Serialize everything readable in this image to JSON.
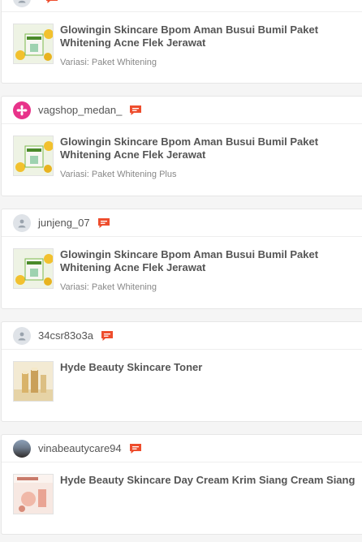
{
  "orders": [
    {
      "username": "",
      "avatar": "default",
      "product": {
        "title": "Glowingin Skincare Bpom Aman Busui Bumil Paket Whitening Acne Flek Jerawat",
        "variant": "Variasi: Paket Whitening",
        "thumb": "whitening-box"
      }
    },
    {
      "username": "vagshop_medan_",
      "avatar": "pink-flower",
      "product": {
        "title": "Glowingin Skincare Bpom Aman Busui Bumil Paket Whitening Acne Flek Jerawat",
        "variant": "Variasi: Paket Whitening Plus",
        "thumb": "whitening-box"
      }
    },
    {
      "username": "junjeng_07",
      "avatar": "default",
      "product": {
        "title": "Glowingin Skincare Bpom Aman Busui Bumil Paket Whitening Acne Flek Jerawat",
        "variant": "Variasi: Paket Whitening",
        "thumb": "whitening-box"
      }
    },
    {
      "username": "34csr83o3a",
      "avatar": "default",
      "product": {
        "title": "Hyde Beauty Skincare Toner",
        "variant": "",
        "thumb": "toner-bottles"
      }
    },
    {
      "username": "vinabeautycare94",
      "avatar": "photo",
      "product": {
        "title": "Hyde Beauty Skincare Day Cream Krim Siang Cream Siang",
        "variant": "",
        "thumb": "sunscreen-cream"
      }
    }
  ],
  "colors": {
    "chat_icon": "#ee4d2d",
    "pink_avatar": "#e8338a",
    "default_avatar": "#dfe3e8"
  }
}
